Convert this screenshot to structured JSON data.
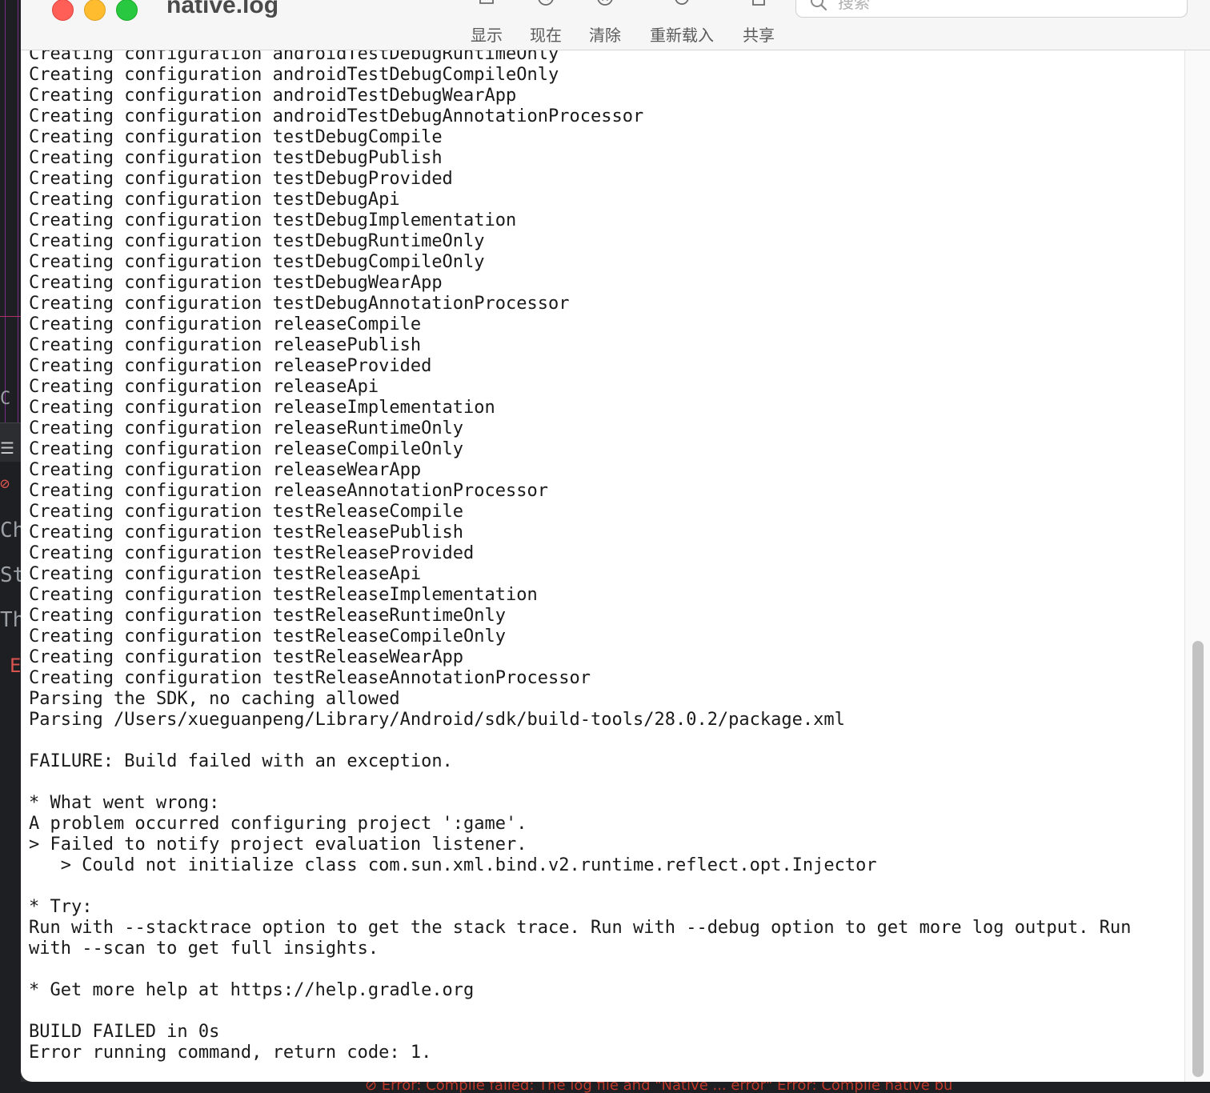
{
  "background": {
    "left_fragments": [
      "C",
      "☰ 找",
      "⊘",
      "Ch",
      "St",
      "Th",
      "E"
    ],
    "bottom_strip_text": "⊘ Error: Compile failed: The log file and \"Native ... error\" Error: Compile native bu"
  },
  "window": {
    "title": "native.log",
    "colors": {
      "close": "#ff5f57",
      "minimize": "#febc2e",
      "zoom": "#28c840"
    }
  },
  "toolbar": {
    "buttons": [
      {
        "id": "show",
        "label": "显示",
        "icon": "tray-download-icon"
      },
      {
        "id": "now",
        "label": "现在",
        "icon": "clock-arrow-icon"
      },
      {
        "id": "clear",
        "label": "清除",
        "icon": "x-circle-icon"
      },
      {
        "id": "reload",
        "label": "重新载入",
        "icon": "reload-icon"
      },
      {
        "id": "share",
        "label": "共享",
        "icon": "share-icon"
      }
    ],
    "search": {
      "placeholder": "搜索",
      "value": ""
    }
  },
  "log": {
    "lines": [
      "Creating configuration androidTestDebugRuntimeOnly",
      "Creating configuration androidTestDebugCompileOnly",
      "Creating configuration androidTestDebugWearApp",
      "Creating configuration androidTestDebugAnnotationProcessor",
      "Creating configuration testDebugCompile",
      "Creating configuration testDebugPublish",
      "Creating configuration testDebugProvided",
      "Creating configuration testDebugApi",
      "Creating configuration testDebugImplementation",
      "Creating configuration testDebugRuntimeOnly",
      "Creating configuration testDebugCompileOnly",
      "Creating configuration testDebugWearApp",
      "Creating configuration testDebugAnnotationProcessor",
      "Creating configuration releaseCompile",
      "Creating configuration releasePublish",
      "Creating configuration releaseProvided",
      "Creating configuration releaseApi",
      "Creating configuration releaseImplementation",
      "Creating configuration releaseRuntimeOnly",
      "Creating configuration releaseCompileOnly",
      "Creating configuration releaseWearApp",
      "Creating configuration releaseAnnotationProcessor",
      "Creating configuration testReleaseCompile",
      "Creating configuration testReleasePublish",
      "Creating configuration testReleaseProvided",
      "Creating configuration testReleaseApi",
      "Creating configuration testReleaseImplementation",
      "Creating configuration testReleaseRuntimeOnly",
      "Creating configuration testReleaseCompileOnly",
      "Creating configuration testReleaseWearApp",
      "Creating configuration testReleaseAnnotationProcessor",
      "Parsing the SDK, no caching allowed",
      "Parsing /Users/xueguanpeng/Library/Android/sdk/build-tools/28.0.2/package.xml",
      "",
      "FAILURE: Build failed with an exception.",
      "",
      "* What went wrong:",
      "A problem occurred configuring project ':game'.",
      "> Failed to notify project evaluation listener.",
      "   > Could not initialize class com.sun.xml.bind.v2.runtime.reflect.opt.Injector",
      "",
      "* Try:",
      "Run with --stacktrace option to get the stack trace. Run with --debug option to get more log output. Run",
      "with --scan to get full insights.",
      "",
      "* Get more help at https://help.gradle.org",
      "",
      "BUILD FAILED in 0s",
      "Error running command, return code: 1."
    ]
  }
}
